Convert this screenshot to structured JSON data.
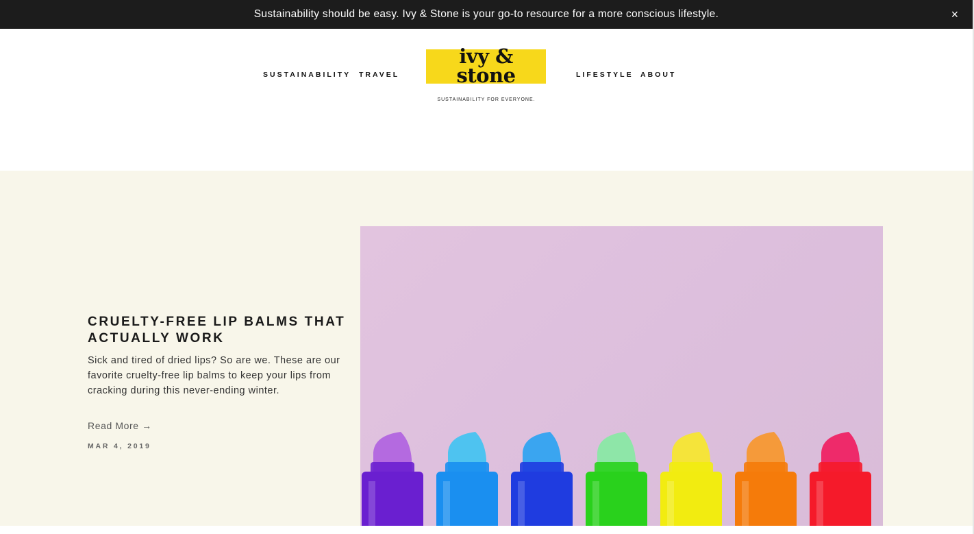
{
  "announcement": {
    "text": "Sustainability should be easy. Ivy & Stone is your go-to resource for a more conscious lifestyle.",
    "close_label": "×"
  },
  "nav": {
    "left": [
      "SUSTAINABILITY",
      "TRAVEL"
    ],
    "right": [
      "LIFESTYLE",
      "ABOUT"
    ]
  },
  "logo": {
    "line1": "ivy &",
    "line2": "stone",
    "tagline": "SUSTAINABILITY FOR EVERYONE.",
    "color": "#f7d81b"
  },
  "feature": {
    "title": "CRUELTY-FREE LIP BALMS THAT ACTUALLY WORK",
    "excerpt": "Sick and tired of dried lips? So are we. These are our favorite cruelty-free lip balms to keep your lips from cracking during this never-ending winter.",
    "read_more": "Read More →",
    "date": "MAR 4, 2019",
    "background": "#f8f6ea"
  },
  "hero": {
    "icon": "lip-balm-photo",
    "balm_colors": [
      {
        "name": "purple",
        "tube": "#6a1fd0",
        "tip": "#b46ae0"
      },
      {
        "name": "light-blue",
        "tube": "#1a8ff0",
        "tip": "#4ec3f0"
      },
      {
        "name": "blue",
        "tube": "#1f3ce0",
        "tip": "#3aa5f0"
      },
      {
        "name": "green",
        "tube": "#29d11c",
        "tip": "#8ee6a8"
      },
      {
        "name": "yellow",
        "tube": "#f2ec10",
        "tip": "#f5e43a"
      },
      {
        "name": "orange",
        "tube": "#f57b0a",
        "tip": "#f59a3a"
      },
      {
        "name": "red",
        "tube": "#f51a2a",
        "tip": "#ee2a6a"
      }
    ]
  }
}
